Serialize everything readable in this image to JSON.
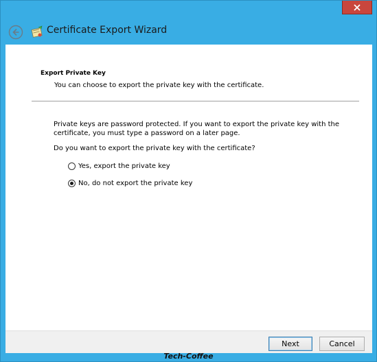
{
  "window": {
    "title": "Certificate Export Wizard",
    "accent_color": "#39ade4",
    "close_color": "#c9463d",
    "close_icon": "close-icon",
    "back_icon": "back-arrow-icon",
    "wizard_icon": "certificate-wizard-icon"
  },
  "page": {
    "heading": "Export Private Key",
    "subheading": "You can choose to export the private key with the certificate.",
    "description": "Private keys are password protected. If you want to export the private key with the certificate, you must type a password on a later page.",
    "question": "Do you want to export the private key with the certificate?",
    "options": [
      {
        "label": "Yes, export the private key",
        "selected": false
      },
      {
        "label": "No, do not export the private key",
        "selected": true
      }
    ]
  },
  "footer": {
    "next_label": "Next",
    "cancel_label": "Cancel"
  },
  "watermark": "Tech-Coffee"
}
